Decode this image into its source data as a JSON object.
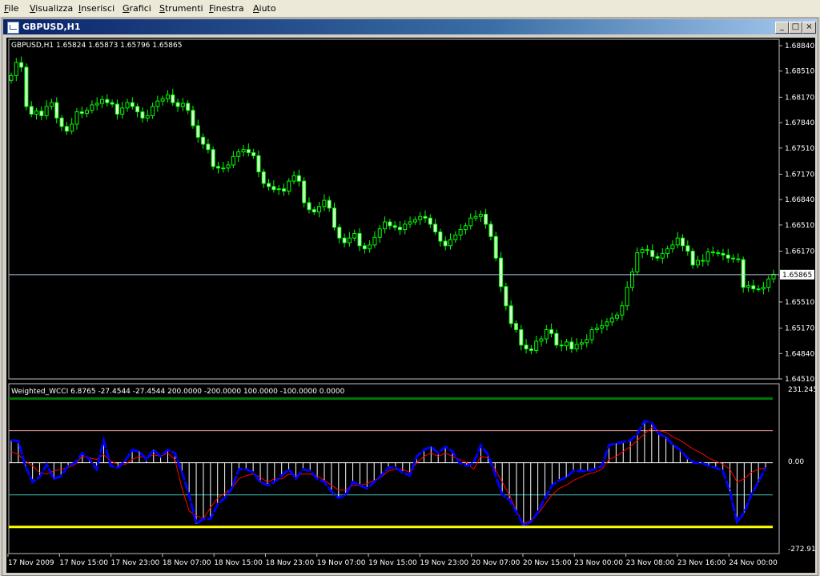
{
  "menu": {
    "items": [
      {
        "label": "File",
        "ul": "F",
        "rest": "ile"
      },
      {
        "label": "Visualizza",
        "ul": "V",
        "rest": "isualizza"
      },
      {
        "label": "Inserisci",
        "ul": "I",
        "rest": "nserisci"
      },
      {
        "label": "Grafici",
        "ul": "G",
        "rest": "rafici"
      },
      {
        "label": "Strumenti",
        "ul": "S",
        "rest": "trumenti"
      },
      {
        "label": "Finestra",
        "ul": "F",
        "rest": "inestra"
      },
      {
        "label": "Aiuto",
        "ul": "A",
        "rest": "iuto"
      }
    ]
  },
  "window": {
    "title": "GBPUSD,H1",
    "minimize_label": "_",
    "maximize_label": "□",
    "close_label": "×"
  },
  "main_chart": {
    "info": "GBPUSD,H1  1.65824 1.65873 1.65796 1.65865",
    "price_labels": [
      "1.68840",
      "1.68510",
      "1.68170",
      "1.67840",
      "1.67510",
      "1.67170",
      "1.66840",
      "1.66510",
      "1.66170",
      "1.65510",
      "1.65170",
      "1.64840",
      "1.64510"
    ],
    "current_price": "1.65865",
    "colors": {
      "bull": "#00ff00",
      "bear": "#d8ffd0",
      "bid": "#b0c4de"
    }
  },
  "indicator": {
    "info": "Weighted_WCCI 6.8765 -27.4544 -27.4544 200.0000 -200.0000 100.0000 -100.0000 0.0000",
    "scale_labels": {
      "top": "231.2455",
      "zero": "0.00",
      "bottom": "-272.916"
    },
    "levels": {
      "plus200": 200,
      "minus200": -200,
      "plus100": 100,
      "minus100": -100,
      "zero": 0
    },
    "colors": {
      "plus200": "#007700",
      "minus200": "#ffff00",
      "plus100": "#ff9ea0",
      "minus100": "#40c0b0",
      "wcci": "#0000ff",
      "signal": "#ff0000",
      "hist": "#ffffff"
    }
  },
  "time_axis": {
    "labels": [
      "17 Nov 2009",
      "17 Nov 15:00",
      "17 Nov 23:00",
      "18 Nov 07:00",
      "18 Nov 15:00",
      "18 Nov 23:00",
      "19 Nov 07:00",
      "19 Nov 15:00",
      "19 Nov 23:00",
      "20 Nov 07:00",
      "20 Nov 15:00",
      "23 Nov 00:00",
      "23 Nov 08:00",
      "23 Nov 16:00",
      "24 Nov 00:00"
    ]
  },
  "chart_data": [
    {
      "type": "candlestick",
      "title": "GBPUSD,H1",
      "ylim": [
        1.6451,
        1.6884
      ],
      "closes": [
        1.6845,
        1.6862,
        1.6856,
        1.6805,
        1.6795,
        1.6799,
        1.6793,
        1.6805,
        1.681,
        1.679,
        1.6779,
        1.6773,
        1.6782,
        1.6798,
        1.6796,
        1.68,
        1.6807,
        1.6809,
        1.6814,
        1.681,
        1.6808,
        1.6795,
        1.6803,
        1.681,
        1.6805,
        1.6798,
        1.679,
        1.6793,
        1.6805,
        1.6812,
        1.6815,
        1.682,
        1.681,
        1.6805,
        1.6809,
        1.68,
        1.678,
        1.6765,
        1.6756,
        1.6749,
        1.6727,
        1.6725,
        1.6725,
        1.6729,
        1.674,
        1.6746,
        1.6749,
        1.6745,
        1.6741,
        1.672,
        1.6705,
        1.6701,
        1.6697,
        1.6698,
        1.6695,
        1.6708,
        1.6715,
        1.6708,
        1.668,
        1.6671,
        1.6668,
        1.6675,
        1.6683,
        1.6673,
        1.6648,
        1.6634,
        1.6628,
        1.6634,
        1.664,
        1.6624,
        1.662,
        1.6625,
        1.6635,
        1.6646,
        1.6655,
        1.665,
        1.6648,
        1.6645,
        1.6652,
        1.6655,
        1.6658,
        1.6662,
        1.666,
        1.6652,
        1.6642,
        1.663,
        1.6624,
        1.6632,
        1.6638,
        1.6645,
        1.665,
        1.666,
        1.6662,
        1.6665,
        1.6652,
        1.6636,
        1.6608,
        1.6571,
        1.6546,
        1.6523,
        1.6515,
        1.6495,
        1.649,
        1.6488,
        1.65,
        1.6503,
        1.6515,
        1.651,
        1.6495,
        1.6494,
        1.6499,
        1.649,
        1.6496,
        1.6498,
        1.6502,
        1.6515,
        1.6517,
        1.652,
        1.6525,
        1.653,
        1.6534,
        1.6546,
        1.657,
        1.659,
        1.6615,
        1.6619,
        1.6618,
        1.661,
        1.6608,
        1.6614,
        1.662,
        1.6625,
        1.6634,
        1.6624,
        1.6617,
        1.6599,
        1.6605,
        1.6604,
        1.6616,
        1.6615,
        1.6614,
        1.6612,
        1.6608,
        1.6607,
        1.6606,
        1.657,
        1.6572,
        1.6568,
        1.6568,
        1.657,
        1.6581,
        1.6587
      ]
    },
    {
      "type": "line",
      "title": "Weighted_WCCI",
      "ylim": [
        -272.916,
        231.2455
      ],
      "series": [
        {
          "name": "WCCI",
          "values": [
            70,
            68,
            -10,
            -60,
            -45,
            -5,
            -50,
            -42,
            -10,
            0,
            30,
            10,
            -20,
            70,
            -10,
            -15,
            5,
            40,
            35,
            10,
            40,
            20,
            40,
            30,
            -30,
            -100,
            -190,
            -175,
            -175,
            -130,
            -110,
            -80,
            -20,
            -20,
            -30,
            -60,
            -70,
            -60,
            -40,
            -20,
            -50,
            -20,
            -25,
            -50,
            -60,
            -90,
            -110,
            -100,
            -60,
            -70,
            -80,
            -60,
            -40,
            -15,
            -15,
            -30,
            -40,
            20,
            40,
            50,
            30,
            50,
            35,
            0,
            -10,
            0,
            55,
            25,
            -35,
            -100,
            -115,
            -155,
            -195,
            -185,
            -155,
            -110,
            -70,
            -55,
            -45,
            -25,
            -25,
            -25,
            -20,
            -10,
            55,
            60,
            65,
            70,
            90,
            130,
            125,
            90,
            80,
            55,
            40,
            15,
            0,
            0,
            -10,
            -15,
            -25,
            -90,
            -185,
            -155,
            -100,
            -60,
            -15
          ]
        },
        {
          "name": "Signal",
          "values": [
            35,
            25,
            5,
            -10,
            -30,
            -35,
            -25,
            -20,
            -15,
            -5,
            20,
            15,
            10,
            25,
            5,
            -5,
            -5,
            10,
            20,
            15,
            25,
            20,
            30,
            10,
            -80,
            -150,
            -165,
            -175,
            -140,
            -110,
            -95,
            -80,
            -50,
            -40,
            -35,
            -45,
            -60,
            -50,
            -50,
            -35,
            -40,
            -35,
            -35,
            -40,
            -55,
            -70,
            -85,
            -85,
            -70,
            -70,
            -65,
            -55,
            -45,
            -25,
            -20,
            -20,
            -30,
            0,
            20,
            30,
            20,
            30,
            20,
            10,
            0,
            -20,
            20,
            15,
            -20,
            -60,
            -100,
            -150,
            -190,
            -180,
            -160,
            -130,
            -100,
            -80,
            -70,
            -55,
            -45,
            -35,
            -30,
            -20,
            10,
            20,
            35,
            50,
            70,
            90,
            110,
            100,
            95,
            80,
            70,
            55,
            40,
            30,
            15,
            5,
            -5,
            -20,
            -60,
            -50,
            -30,
            -20,
            -15
          ]
        }
      ]
    }
  ]
}
